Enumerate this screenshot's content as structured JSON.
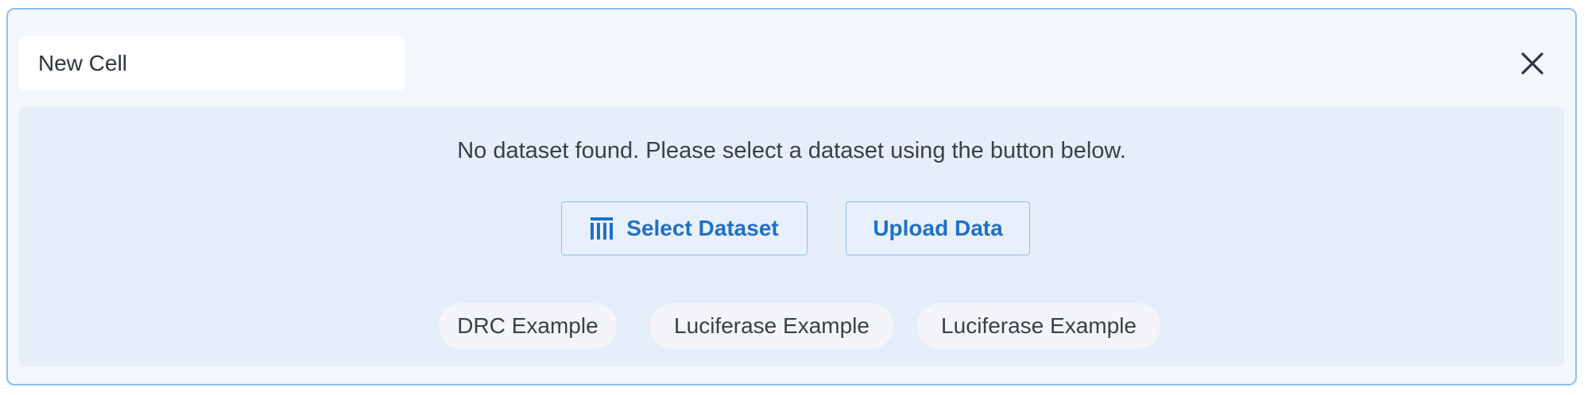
{
  "cell": {
    "title_value": "New Cell",
    "close_icon": "close-icon"
  },
  "panel": {
    "message": "No dataset found. Please select a dataset using the button below.",
    "select_dataset_label": "Select Dataset",
    "select_dataset_icon": "table-columns-icon",
    "upload_data_label": "Upload Data",
    "examples": [
      {
        "label": "DRC Example"
      },
      {
        "label": "Luciferase Example"
      },
      {
        "label": "Luciferase Example"
      }
    ]
  },
  "colors": {
    "accent": "#1f6fc6",
    "border": "#8fbdf0",
    "panel_bg": "#e6eff9",
    "cell_bg": "#f3f6fa"
  }
}
